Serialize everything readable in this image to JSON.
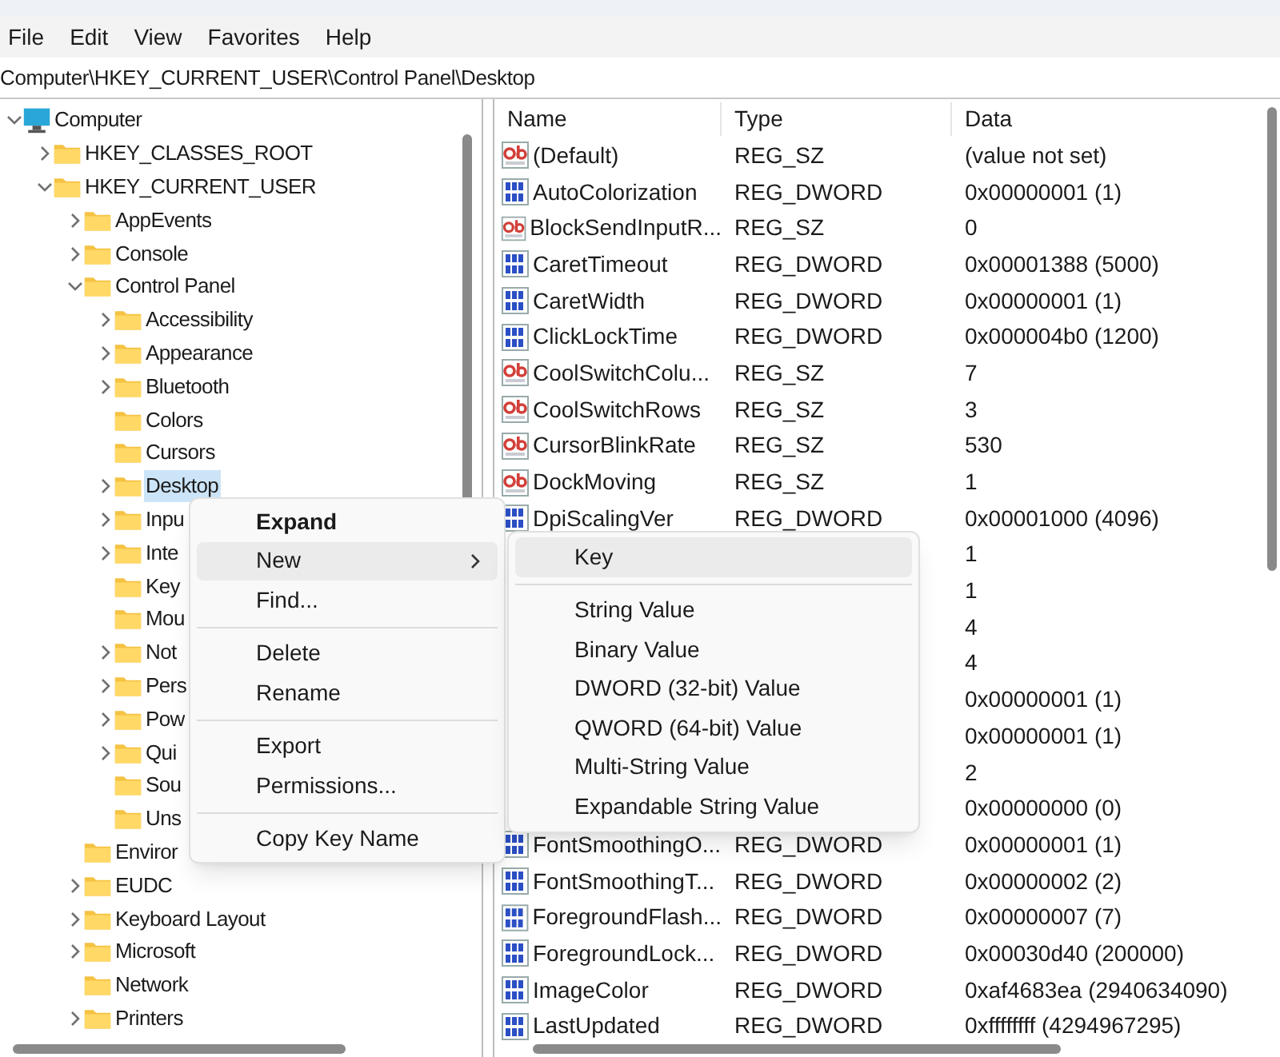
{
  "menu_bar": [
    "File",
    "Edit",
    "View",
    "Favorites",
    "Help"
  ],
  "address": "Computer\\HKEY_CURRENT_USER\\Control Panel\\Desktop",
  "tree": [
    {
      "label": "Computer",
      "kind": "computer",
      "expanded": true,
      "selected": false,
      "children": [
        {
          "label": "HKEY_CLASSES_ROOT",
          "expanded": false,
          "has_children": true,
          "selected": false
        },
        {
          "label": "HKEY_CURRENT_USER",
          "expanded": true,
          "has_children": true,
          "selected": false,
          "children": [
            {
              "label": "AppEvents",
              "expanded": false,
              "has_children": true,
              "selected": false
            },
            {
              "label": "Console",
              "expanded": false,
              "has_children": true,
              "selected": false
            },
            {
              "label": "Control Panel",
              "expanded": true,
              "has_children": true,
              "selected": false,
              "children": [
                {
                  "label": "Accessibility",
                  "expanded": false,
                  "has_children": true,
                  "selected": false
                },
                {
                  "label": "Appearance",
                  "expanded": false,
                  "has_children": true,
                  "selected": false
                },
                {
                  "label": "Bluetooth",
                  "expanded": false,
                  "has_children": true,
                  "selected": false
                },
                {
                  "label": "Colors",
                  "expanded": false,
                  "has_children": false,
                  "selected": false
                },
                {
                  "label": "Cursors",
                  "expanded": false,
                  "has_children": false,
                  "selected": false
                },
                {
                  "label": "Desktop",
                  "expanded": false,
                  "has_children": true,
                  "selected": true
                },
                {
                  "label": "Inpu",
                  "expanded": false,
                  "has_children": true,
                  "selected": false
                },
                {
                  "label": "Inte",
                  "expanded": false,
                  "has_children": true,
                  "selected": false
                },
                {
                  "label": "Key",
                  "expanded": false,
                  "has_children": false,
                  "selected": false
                },
                {
                  "label": "Mou",
                  "expanded": false,
                  "has_children": false,
                  "selected": false
                },
                {
                  "label": "Not",
                  "expanded": false,
                  "has_children": true,
                  "selected": false
                },
                {
                  "label": "Pers",
                  "expanded": false,
                  "has_children": true,
                  "selected": false
                },
                {
                  "label": "Pow",
                  "expanded": false,
                  "has_children": true,
                  "selected": false
                },
                {
                  "label": "Qui",
                  "expanded": false,
                  "has_children": true,
                  "selected": false
                },
                {
                  "label": "Sou",
                  "expanded": false,
                  "has_children": false,
                  "selected": false
                },
                {
                  "label": "Uns",
                  "expanded": false,
                  "has_children": false,
                  "selected": false
                }
              ]
            },
            {
              "label": "Enviror",
              "expanded": false,
              "has_children": false,
              "selected": false
            },
            {
              "label": "EUDC",
              "expanded": false,
              "has_children": true,
              "selected": false
            },
            {
              "label": "Keyboard Layout",
              "expanded": false,
              "has_children": true,
              "selected": false
            },
            {
              "label": "Microsoft",
              "expanded": false,
              "has_children": true,
              "selected": false
            },
            {
              "label": "Network",
              "expanded": false,
              "has_children": false,
              "selected": false
            },
            {
              "label": "Printers",
              "expanded": false,
              "has_children": true,
              "selected": false
            }
          ]
        }
      ]
    }
  ],
  "table": {
    "columns": [
      "Name",
      "Type",
      "Data"
    ],
    "rows": [
      {
        "kind": "string",
        "name": "(Default)",
        "type": "REG_SZ",
        "data": "(value not set)"
      },
      {
        "kind": "dword",
        "name": "AutoColorization",
        "type": "REG_DWORD",
        "data": "0x00000001 (1)"
      },
      {
        "kind": "string",
        "name": "BlockSendInputR...",
        "type": "REG_SZ",
        "data": "0"
      },
      {
        "kind": "dword",
        "name": "CaretTimeout",
        "type": "REG_DWORD",
        "data": "0x00001388 (5000)"
      },
      {
        "kind": "dword",
        "name": "CaretWidth",
        "type": "REG_DWORD",
        "data": "0x00000001 (1)"
      },
      {
        "kind": "dword",
        "name": "ClickLockTime",
        "type": "REG_DWORD",
        "data": "0x000004b0 (1200)"
      },
      {
        "kind": "string",
        "name": "CoolSwitchColu...",
        "type": "REG_SZ",
        "data": "7"
      },
      {
        "kind": "string",
        "name": "CoolSwitchRows",
        "type": "REG_SZ",
        "data": "3"
      },
      {
        "kind": "string",
        "name": "CursorBlinkRate",
        "type": "REG_SZ",
        "data": "530"
      },
      {
        "kind": "string",
        "name": "DockMoving",
        "type": "REG_SZ",
        "data": "1"
      },
      {
        "kind": "dword",
        "name": "DpiScalingVer",
        "type": "REG_DWORD",
        "data": "0x00001000 (4096)"
      },
      {
        "data": "1"
      },
      {
        "data": "1"
      },
      {
        "data": "4"
      },
      {
        "data": "4"
      },
      {
        "data": "0x00000001 (1)"
      },
      {
        "data": "0x00000001 (1)"
      },
      {
        "data": "2"
      },
      {
        "data": "0x00000000 (0)"
      },
      {
        "kind": "dword",
        "name": "FontSmoothingO...",
        "type": "REG_DWORD",
        "data": "0x00000001 (1)"
      },
      {
        "kind": "dword",
        "name": "FontSmoothingT...",
        "type": "REG_DWORD",
        "data": "0x00000002 (2)"
      },
      {
        "kind": "dword",
        "name": "ForegroundFlash...",
        "type": "REG_DWORD",
        "data": "0x00000007 (7)"
      },
      {
        "kind": "dword",
        "name": "ForegroundLock...",
        "type": "REG_DWORD",
        "data": "0x00030d40 (200000)"
      },
      {
        "kind": "dword",
        "name": "ImageColor",
        "type": "REG_DWORD",
        "data": "0xaf4683ea (2940634090)"
      },
      {
        "kind": "dword",
        "name": "LastUpdated",
        "type": "REG_DWORD",
        "data": "0xffffffff (4294967295)"
      }
    ]
  },
  "context_menu": {
    "groups": [
      [
        {
          "label": "Expand",
          "bold": true,
          "selected": false
        },
        {
          "label": "New",
          "submenu": true,
          "selected": true
        },
        {
          "label": "Find...",
          "selected": false
        }
      ],
      [
        {
          "label": "Delete",
          "selected": false
        },
        {
          "label": "Rename",
          "selected": false
        }
      ],
      [
        {
          "label": "Export",
          "selected": false
        },
        {
          "label": "Permissions...",
          "selected": false
        }
      ],
      [
        {
          "label": "Copy Key Name",
          "selected": false
        }
      ]
    ]
  },
  "submenu": {
    "groups": [
      [
        {
          "label": "Key",
          "selected": true
        }
      ],
      [
        {
          "label": "String Value",
          "selected": false
        },
        {
          "label": "Binary Value",
          "selected": false
        },
        {
          "label": "DWORD (32-bit) Value",
          "selected": false
        },
        {
          "label": "QWORD (64-bit) Value",
          "selected": false
        },
        {
          "label": "Multi-String Value",
          "selected": false
        },
        {
          "label": "Expandable String Value",
          "selected": false
        }
      ]
    ]
  }
}
